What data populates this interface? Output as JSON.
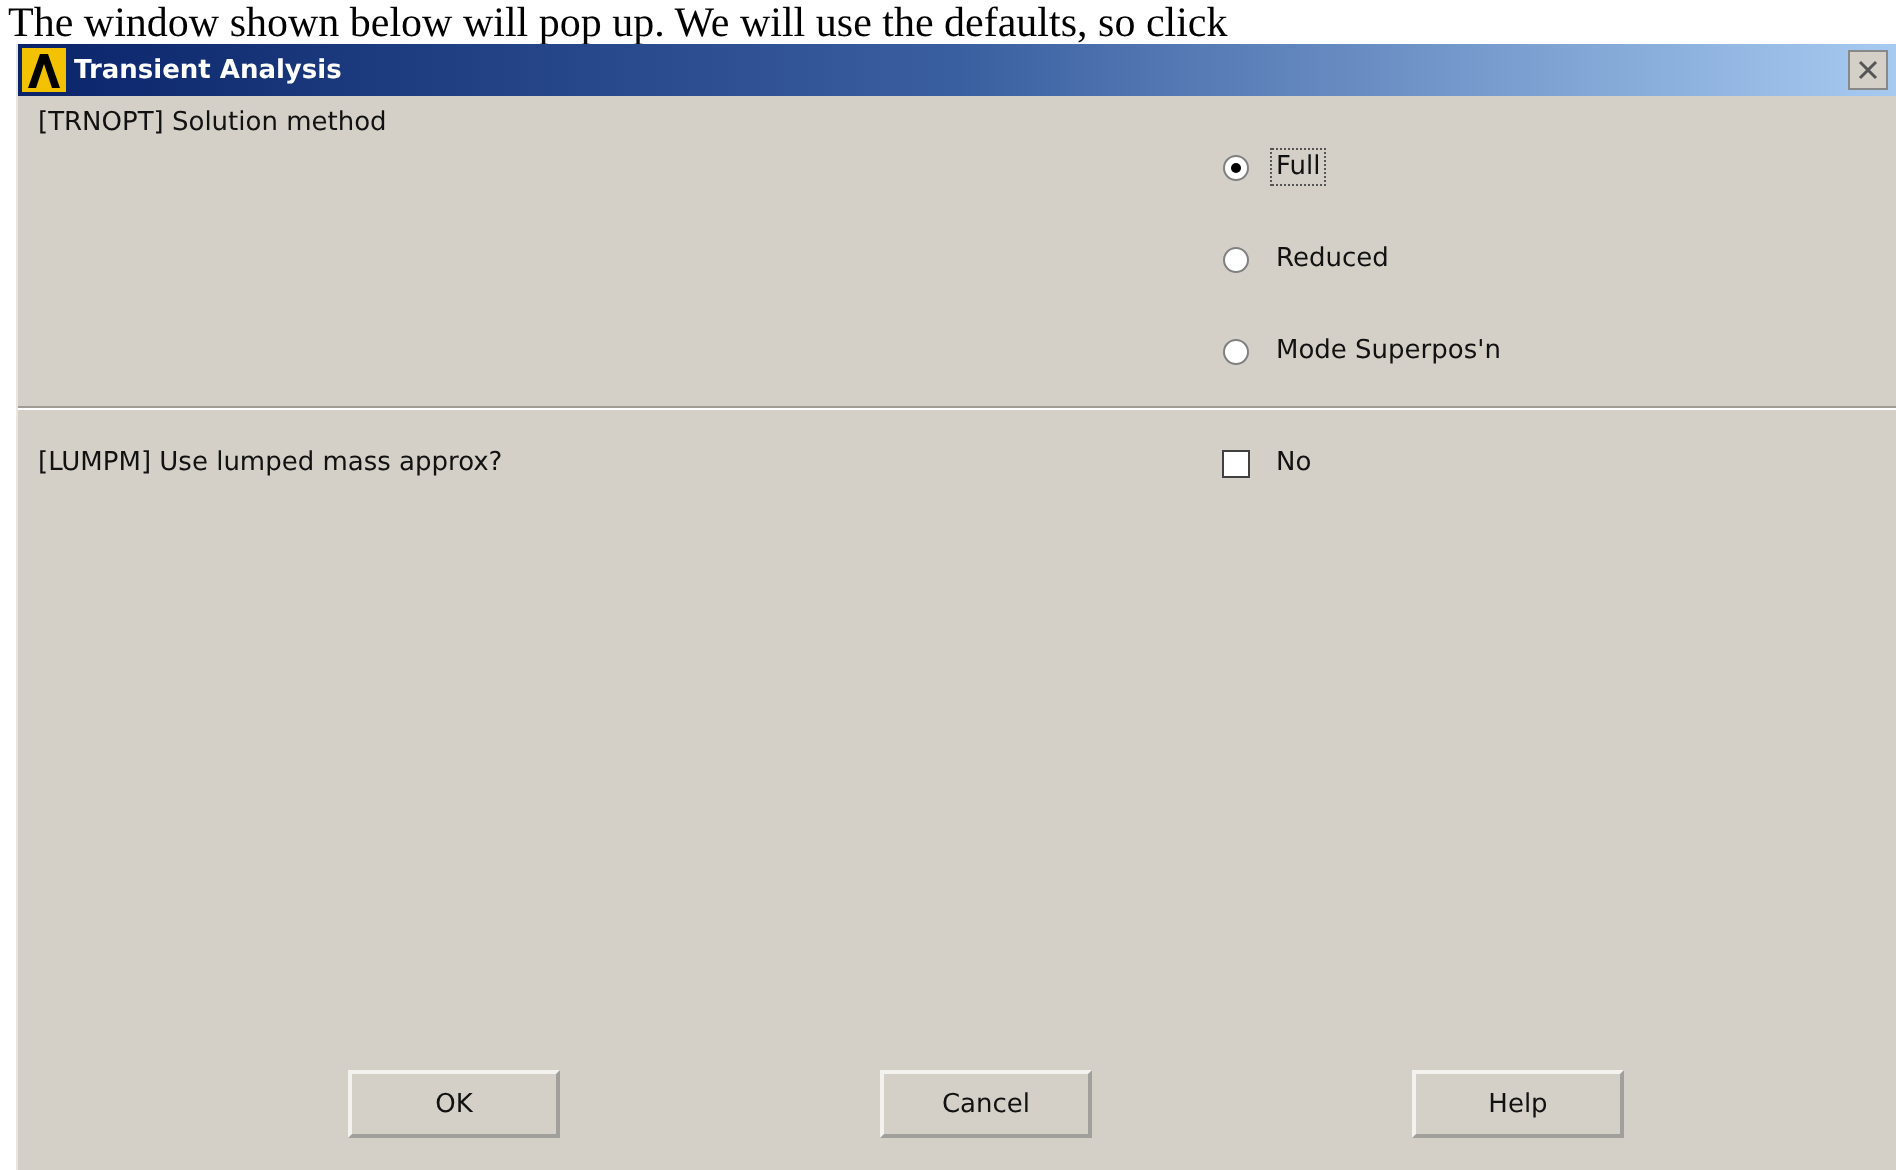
{
  "page_text": "The window shown below will pop up. We will use the defaults, so click",
  "window": {
    "title": "Transient Analysis"
  },
  "sections": [
    {
      "label": "[TRNOPT]  Solution method",
      "kind": "radio",
      "options": [
        {
          "label": "Full",
          "selected": true
        },
        {
          "label": "Reduced",
          "selected": false
        },
        {
          "label": "Mode Superpos'n",
          "selected": false
        }
      ]
    },
    {
      "label": "[LUMPM]  Use lumped mass approx?",
      "kind": "checkbox",
      "options": [
        {
          "label": "No",
          "checked": false
        }
      ]
    }
  ],
  "buttons": [
    "OK",
    "Cancel",
    "Help"
  ]
}
